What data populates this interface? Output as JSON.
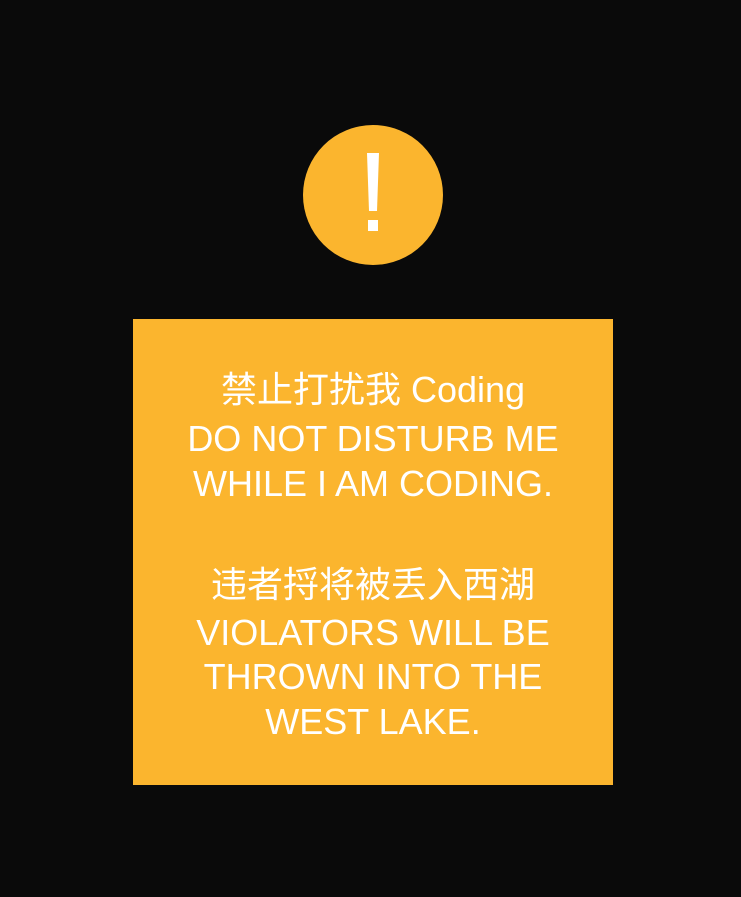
{
  "alert": {
    "icon": "exclamation-icon",
    "color": "#fbb52e"
  },
  "notice": {
    "background": "#fbb52e",
    "text_color": "#ffffff",
    "line1": "禁止打扰我 Coding",
    "line2": "DO NOT DISTURB ME",
    "line3": "WHILE I AM CODING.",
    "line4": "违者捋将被丢入西湖",
    "line5": "VIOLATORS WILL BE",
    "line6": "THROWN INTO THE",
    "line7": "WEST LAKE."
  },
  "page": {
    "background": "#0a0a0a"
  }
}
